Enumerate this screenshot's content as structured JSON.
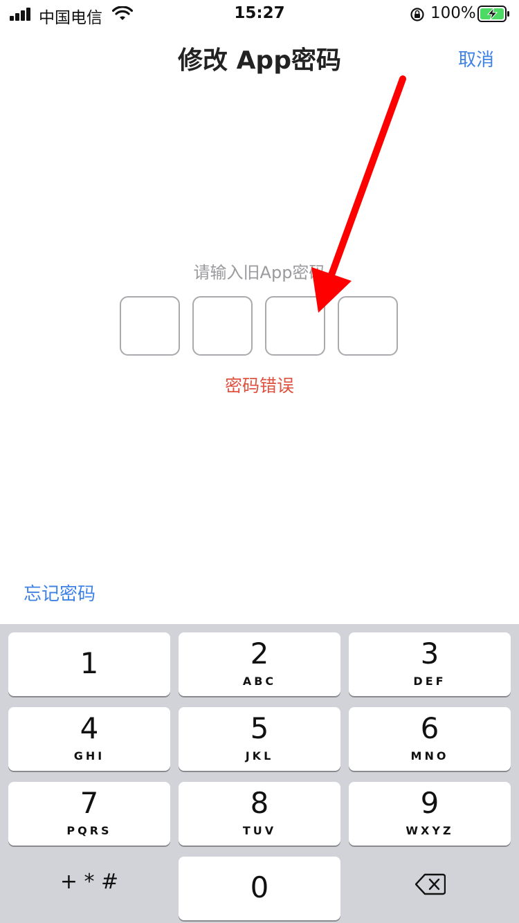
{
  "status": {
    "carrier": "中国电信",
    "time": "15:27",
    "battery_percent": "100%",
    "icons": [
      "signal-icon",
      "wifi-icon",
      "rotation-lock-icon",
      "battery-charging-icon"
    ]
  },
  "nav": {
    "title": "修改 App密码",
    "cancel_label": "取消"
  },
  "passcode": {
    "prompt": "请输入旧App密码",
    "digit_count": 4,
    "error": "密码错误"
  },
  "forgot_label": "忘记密码",
  "keypad": {
    "keys": [
      {
        "num": "1",
        "letters": ""
      },
      {
        "num": "2",
        "letters": "ABC"
      },
      {
        "num": "3",
        "letters": "DEF"
      },
      {
        "num": "4",
        "letters": "GHI"
      },
      {
        "num": "5",
        "letters": "JKL"
      },
      {
        "num": "6",
        "letters": "MNO"
      },
      {
        "num": "7",
        "letters": "PQRS"
      },
      {
        "num": "8",
        "letters": "TUV"
      },
      {
        "num": "9",
        "letters": "WXYZ"
      },
      {
        "num": "0",
        "letters": ""
      }
    ],
    "symbols_label": "+ * #",
    "delete_icon": "backspace-icon"
  },
  "colors": {
    "accent": "#3f82e6",
    "error": "#e0513f",
    "arrow": "#ff0000",
    "keypad_bg": "#d1d3d9"
  }
}
